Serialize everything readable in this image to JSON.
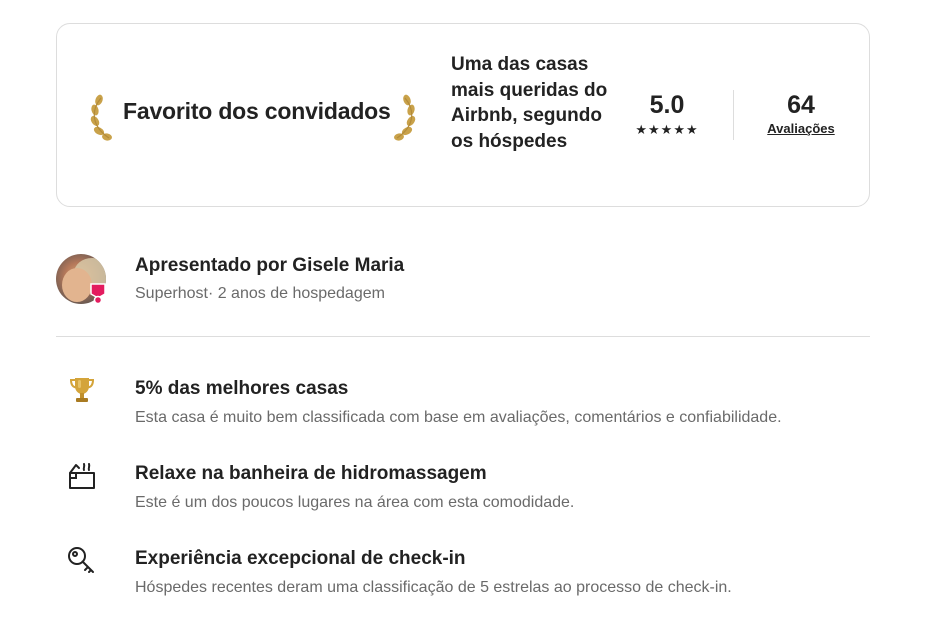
{
  "guest_favorite": {
    "title": "Favorito dos convidados",
    "description": "Uma das casas mais queridas do Airbnb, segundo os hóspedes",
    "rating": "5.0",
    "stars": "★★★★★",
    "reviews_count": "64",
    "reviews_label": "Avaliações"
  },
  "host": {
    "title": "Apresentado por Gisele Maria",
    "subtitle": "Superhost· 2 anos de hospedagem"
  },
  "highlights": [
    {
      "icon": "trophy-icon",
      "title": "5% das melhores casas",
      "description": "Esta casa é muito bem classificada com base em avaliações, comentários e confiabilidade."
    },
    {
      "icon": "hot-tub-icon",
      "title": "Relaxe na banheira de hidromassagem",
      "description": "Este é um dos poucos lugares na área com esta comodidade."
    },
    {
      "icon": "key-icon",
      "title": "Experiência excepcional de check-in",
      "description": "Hóspedes recentes deram uma classificação de 5 estrelas ao processo de check-in."
    }
  ],
  "colors": {
    "text": "#222222",
    "muted": "#6a6a6a",
    "border": "#dddddd",
    "laurel_gold": "#c9a24a",
    "superhost_pink": "#e31c5f"
  }
}
